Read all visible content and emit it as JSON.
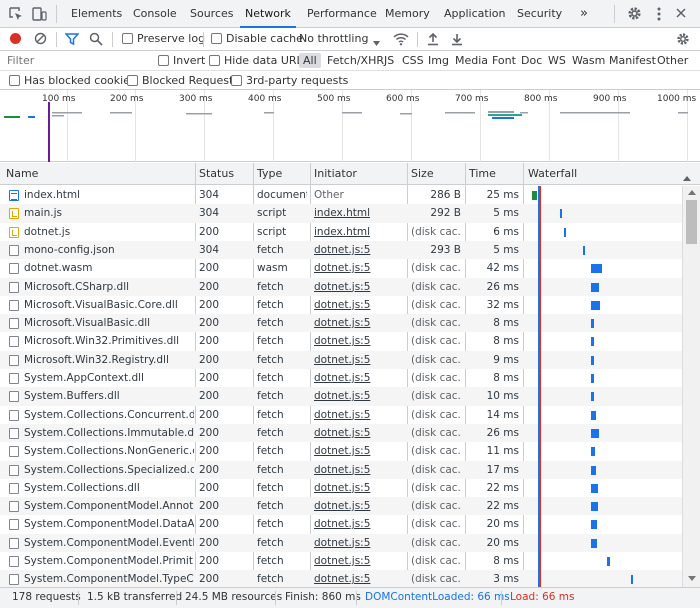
{
  "tabs": [
    {
      "label": "Elements"
    },
    {
      "label": "Console"
    },
    {
      "label": "Sources"
    },
    {
      "label": "Network"
    },
    {
      "label": "Performance"
    },
    {
      "label": "Memory"
    },
    {
      "label": "Application"
    },
    {
      "label": "Security"
    }
  ],
  "tabs_more": "»",
  "toolbar": {
    "preserve_log": "Preserve log",
    "disable_cache": "Disable cache",
    "throttling": "No throttling"
  },
  "filter": {
    "placeholder": "Filter",
    "invert": "Invert",
    "hide_data_urls": "Hide data URLs",
    "types": [
      "All",
      "Fetch/XHR",
      "JS",
      "CSS",
      "Img",
      "Media",
      "Font",
      "Doc",
      "WS",
      "Wasm",
      "Manifest",
      "Other"
    ]
  },
  "options": {
    "blocked_cookies": "Has blocked cookies",
    "blocked_requests": "Blocked Requests",
    "third_party": "3rd-party requests"
  },
  "overview": {
    "ticks": [
      "100 ms",
      "200 ms",
      "300 ms",
      "400 ms",
      "500 ms",
      "600 ms",
      "700 ms",
      "800 ms",
      "900 ms",
      "1000 ms"
    ]
  },
  "columns": {
    "name": "Name",
    "status": "Status",
    "type": "Type",
    "initiator": "Initiator",
    "size": "Size",
    "time": "Time",
    "waterfall": "Waterfall"
  },
  "rows": [
    {
      "name": "index.html",
      "status": "304",
      "type": "document",
      "initiator": "Other",
      "size": "286 B",
      "time": "25 ms",
      "icon": "document-file-icon",
      "initiator_link": false,
      "wf_start": 0.01,
      "wf_len": 0.025
    },
    {
      "name": "main.js",
      "status": "304",
      "type": "script",
      "initiator": "index.html",
      "size": "292 B",
      "time": "5 ms",
      "icon": "script-file-icon",
      "initiator_link": true,
      "wf_start": 0.045,
      "wf_len": 0.008
    },
    {
      "name": "dotnet.js",
      "status": "200",
      "type": "script",
      "initiator": "index.html",
      "size": "(disk cac...",
      "time": "6 ms",
      "icon": "script-file-icon",
      "initiator_link": true,
      "wf_start": 0.05,
      "wf_len": 0.009
    },
    {
      "name": "mono-config.json",
      "status": "304",
      "type": "fetch",
      "initiator": "dotnet.js:5",
      "size": "293 B",
      "time": "5 ms",
      "icon": "file-icon",
      "initiator_link": true,
      "wf_start": 0.075,
      "wf_len": 0.008
    },
    {
      "name": "dotnet.wasm",
      "status": "200",
      "type": "wasm",
      "initiator": "dotnet.js:5",
      "size": "(disk cac...",
      "time": "42 ms",
      "icon": "file-icon",
      "initiator_link": true,
      "wf_start": 0.085,
      "wf_len": 0.055
    },
    {
      "name": "Microsoft.CSharp.dll",
      "status": "200",
      "type": "fetch",
      "initiator": "dotnet.js:5",
      "size": "(disk cac...",
      "time": "26 ms",
      "icon": "file-icon",
      "initiator_link": true,
      "wf_start": 0.085,
      "wf_len": 0.04
    },
    {
      "name": "Microsoft.VisualBasic.Core.dll",
      "status": "200",
      "type": "fetch",
      "initiator": "dotnet.js:5",
      "size": "(disk cac...",
      "time": "32 ms",
      "icon": "file-icon",
      "initiator_link": true,
      "wf_start": 0.085,
      "wf_len": 0.045
    },
    {
      "name": "Microsoft.VisualBasic.dll",
      "status": "200",
      "type": "fetch",
      "initiator": "dotnet.js:5",
      "size": "(disk cac...",
      "time": "8 ms",
      "icon": "file-icon",
      "initiator_link": true,
      "wf_start": 0.085,
      "wf_len": 0.014
    },
    {
      "name": "Microsoft.Win32.Primitives.dll",
      "status": "200",
      "type": "fetch",
      "initiator": "dotnet.js:5",
      "size": "(disk cac...",
      "time": "8 ms",
      "icon": "file-icon",
      "initiator_link": true,
      "wf_start": 0.085,
      "wf_len": 0.014
    },
    {
      "name": "Microsoft.Win32.Registry.dll",
      "status": "200",
      "type": "fetch",
      "initiator": "dotnet.js:5",
      "size": "(disk cac...",
      "time": "9 ms",
      "icon": "file-icon",
      "initiator_link": true,
      "wf_start": 0.085,
      "wf_len": 0.015
    },
    {
      "name": "System.AppContext.dll",
      "status": "200",
      "type": "fetch",
      "initiator": "dotnet.js:5",
      "size": "(disk cac...",
      "time": "8 ms",
      "icon": "file-icon",
      "initiator_link": true,
      "wf_start": 0.085,
      "wf_len": 0.014
    },
    {
      "name": "System.Buffers.dll",
      "status": "200",
      "type": "fetch",
      "initiator": "dotnet.js:5",
      "size": "(disk cac...",
      "time": "10 ms",
      "icon": "file-icon",
      "initiator_link": true,
      "wf_start": 0.085,
      "wf_len": 0.016
    },
    {
      "name": "System.Collections.Concurrent.dll",
      "status": "200",
      "type": "fetch",
      "initiator": "dotnet.js:5",
      "size": "(disk cac...",
      "time": "14 ms",
      "icon": "file-icon",
      "initiator_link": true,
      "wf_start": 0.085,
      "wf_len": 0.022
    },
    {
      "name": "System.Collections.Immutable.dll",
      "status": "200",
      "type": "fetch",
      "initiator": "dotnet.js:5",
      "size": "(disk cac...",
      "time": "26 ms",
      "icon": "file-icon",
      "initiator_link": true,
      "wf_start": 0.085,
      "wf_len": 0.04
    },
    {
      "name": "System.Collections.NonGeneric.dll",
      "status": "200",
      "type": "fetch",
      "initiator": "dotnet.js:5",
      "size": "(disk cac...",
      "time": "11 ms",
      "icon": "file-icon",
      "initiator_link": true,
      "wf_start": 0.085,
      "wf_len": 0.018
    },
    {
      "name": "System.Collections.Specialized.dll",
      "status": "200",
      "type": "fetch",
      "initiator": "dotnet.js:5",
      "size": "(disk cac...",
      "time": "17 ms",
      "icon": "file-icon",
      "initiator_link": true,
      "wf_start": 0.085,
      "wf_len": 0.026
    },
    {
      "name": "System.Collections.dll",
      "status": "200",
      "type": "fetch",
      "initiator": "dotnet.js:5",
      "size": "(disk cac...",
      "time": "22 ms",
      "icon": "file-icon",
      "initiator_link": true,
      "wf_start": 0.085,
      "wf_len": 0.033
    },
    {
      "name": "System.ComponentModel.Annotat...",
      "status": "200",
      "type": "fetch",
      "initiator": "dotnet.js:5",
      "size": "(disk cac...",
      "time": "22 ms",
      "icon": "file-icon",
      "initiator_link": true,
      "wf_start": 0.085,
      "wf_len": 0.033
    },
    {
      "name": "System.ComponentModel.DataAn...",
      "status": "200",
      "type": "fetch",
      "initiator": "dotnet.js:5",
      "size": "(disk cac...",
      "time": "20 ms",
      "icon": "file-icon",
      "initiator_link": true,
      "wf_start": 0.085,
      "wf_len": 0.03
    },
    {
      "name": "System.ComponentModel.EventBa...",
      "status": "200",
      "type": "fetch",
      "initiator": "dotnet.js:5",
      "size": "(disk cac...",
      "time": "20 ms",
      "icon": "file-icon",
      "initiator_link": true,
      "wf_start": 0.085,
      "wf_len": 0.03
    },
    {
      "name": "System.ComponentModel.Primitiv...",
      "status": "200",
      "type": "fetch",
      "initiator": "dotnet.js:5",
      "size": "(disk cac...",
      "time": "8 ms",
      "icon": "file-icon",
      "initiator_link": true,
      "wf_start": 0.105,
      "wf_len": 0.014
    },
    {
      "name": "System.ComponentModel.TypeCo...",
      "status": "200",
      "type": "fetch",
      "initiator": "dotnet.js:5",
      "size": "(disk cac...",
      "time": "3 ms",
      "icon": "file-icon",
      "initiator_link": true,
      "wf_start": 0.135,
      "wf_len": 0.008
    }
  ],
  "status_bar": {
    "requests": "178 requests",
    "transferred": "1.5 kB transferred",
    "resources": "24.5 MB resources",
    "finish": "Finish: 860 ms",
    "dom_content_loaded": "DOMContentLoaded: 66 ms",
    "load": "Load: 66 ms"
  },
  "colors": {
    "accent": "#1a73e8",
    "record_red": "#d93025",
    "dom_blue": "#1a73e8",
    "load_red": "#d93025"
  }
}
